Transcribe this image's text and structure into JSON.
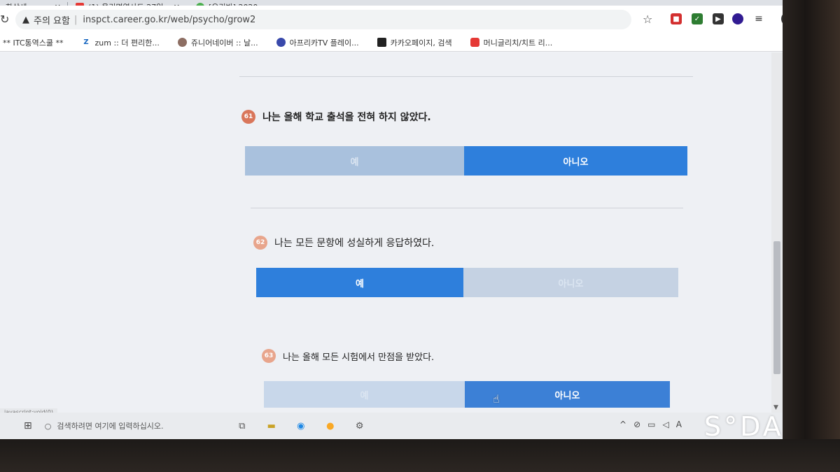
{
  "browser": {
    "tabs": [
      {
        "label": "화상세",
        "color": "#9aa0a6"
      },
      {
        "label": "(1) 올리면역사도 27일",
        "color": "#e53935"
      },
      {
        "label": "[우리반] 2020",
        "color": "#4caf50"
      }
    ],
    "address": {
      "warning_label": "주의 요함",
      "url": "inspct.career.go.kr/web/psycho/grow2"
    },
    "bookmarks": [
      {
        "label": "** ITC통역스쿨 **",
        "icon": "dot-icon",
        "icon_char": "",
        "color": "#888888"
      },
      {
        "label": "zum :: 더 편리한...",
        "icon": "zum-icon",
        "icon_char": "Z",
        "color": "#1565c0"
      },
      {
        "label": "쥬니어네이버 :: 날...",
        "icon": "junior-naver-icon",
        "icon_char": "",
        "color": "#8d6e63"
      },
      {
        "label": "아프리카TV 플레이...",
        "icon": "afreecatv-icon",
        "icon_char": "",
        "color": "#3949ab"
      },
      {
        "label": "카카오페이지, 검색",
        "icon": "kakaopage-icon",
        "icon_char": "",
        "color": "#222222"
      },
      {
        "label": "머니글리치/치트 리...",
        "icon": "youtube-icon",
        "icon_char": "",
        "color": "#e53935"
      }
    ]
  },
  "survey": {
    "questions": [
      {
        "number": "61",
        "text": "나는 올해 학교 출석을 전혀 하지 않았다.",
        "yes": "예",
        "no": "아니오",
        "selected": "no"
      },
      {
        "number": "62",
        "text": "나는 모든 문항에 성실하게 응답하였다.",
        "yes": "예",
        "no": "아니오",
        "selected": "yes"
      },
      {
        "number": "63",
        "text": "나는 올해 모든 시험에서 만점을 받았다.",
        "yes": "예",
        "no": "아니오",
        "selected": "no"
      }
    ]
  },
  "status_bar": {
    "text": "javascript:void(0)"
  },
  "taskbar": {
    "search_placeholder": "검색하려면 여기에 입력하십시오."
  },
  "watermark": {
    "text": "S°DA"
  },
  "colors": {
    "selected": "#2e7fdc",
    "unselected": "#a9c1dd",
    "qnum": "#d9765a"
  }
}
